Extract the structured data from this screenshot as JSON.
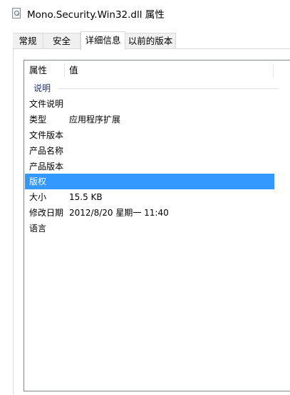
{
  "window": {
    "title": "Mono.Security.Win32.dll 属性"
  },
  "tabs": [
    {
      "label": "常规"
    },
    {
      "label": "安全"
    },
    {
      "label": "详细信息",
      "selected": true
    },
    {
      "label": "以前的版本"
    }
  ],
  "details": {
    "header": {
      "property": "属性",
      "value": "值"
    },
    "group_label": "说明",
    "rows": [
      {
        "property": "文件说明",
        "value": ""
      },
      {
        "property": "类型",
        "value": "应用程序扩展"
      },
      {
        "property": "文件版本",
        "value": ""
      },
      {
        "property": "产品名称",
        "value": ""
      },
      {
        "property": "产品版本",
        "value": ""
      },
      {
        "property": "版权",
        "value": "",
        "selected": true
      },
      {
        "property": "大小",
        "value": "15.5 KB"
      },
      {
        "property": "修改日期",
        "value": "2012/8/20 星期一 11:40"
      },
      {
        "property": "语言",
        "value": ""
      }
    ]
  },
  "colors": {
    "selection": "#3399ff",
    "group_label": "#1e3287"
  },
  "icons": {
    "title": "file-properties-icon"
  }
}
